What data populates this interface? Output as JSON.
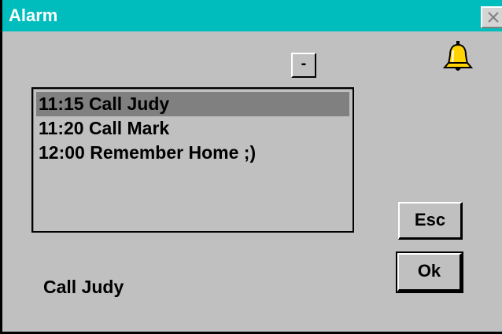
{
  "window": {
    "title": "Alarm",
    "colors": {
      "titlebar": "#00bdbd",
      "face": "#c0c0c0",
      "selection": "#808080"
    }
  },
  "toolbar": {
    "minus_label": "-",
    "close_icon": "close-icon",
    "bell_icon": "bell-icon"
  },
  "alarms": {
    "items": [
      {
        "label": "11:15 Call Judy",
        "selected": true
      },
      {
        "label": "11:20 Call Mark",
        "selected": false
      },
      {
        "label": "12:00 Remember Home ;)",
        "selected": false
      }
    ]
  },
  "status": {
    "text": "Call Judy"
  },
  "buttons": {
    "esc_label": "Esc",
    "ok_label": "Ok"
  }
}
